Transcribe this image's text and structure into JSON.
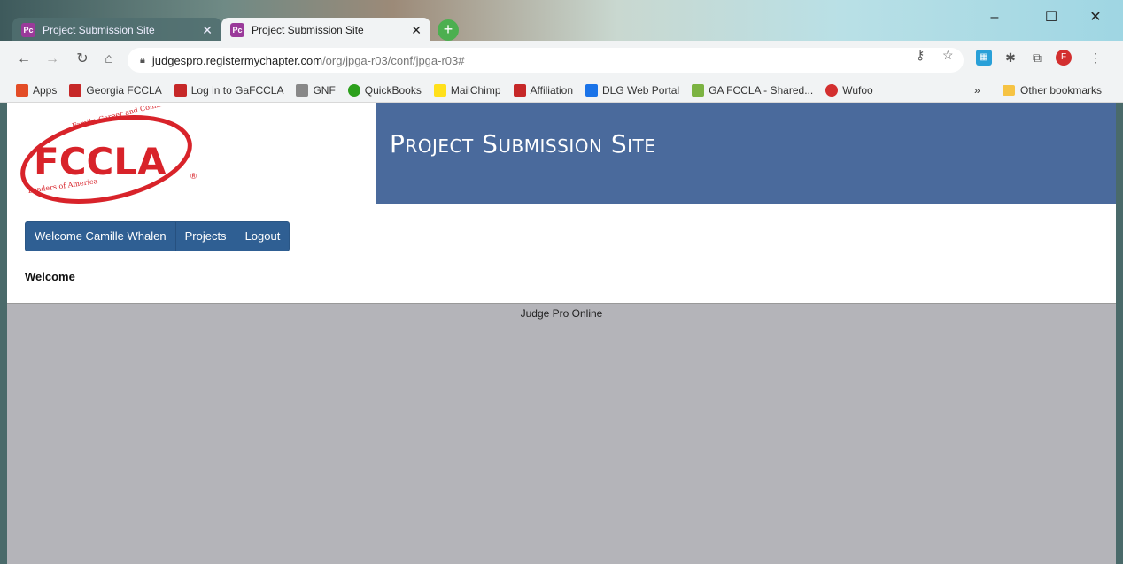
{
  "tabs": [
    {
      "label": "Project Submission Site",
      "favicon": "Pc"
    },
    {
      "label": "Project Submission Site",
      "favicon": "Pc"
    }
  ],
  "address": {
    "host": "judgespro.registermychapter.com",
    "path": "/org/jpga-r03/conf/jpga-r03#"
  },
  "bookmarks": [
    {
      "label": "Apps",
      "color": "#e34c26"
    },
    {
      "label": "Georgia FCCLA",
      "color": "#c62828"
    },
    {
      "label": "Log in to GaFCCLA",
      "color": "#c62828"
    },
    {
      "label": "GNF",
      "color": "#888888"
    },
    {
      "label": "QuickBooks",
      "color": "#2ca01c"
    },
    {
      "label": "MailChimp",
      "color": "#ffe01b"
    },
    {
      "label": "Affiliation",
      "color": "#c62828"
    },
    {
      "label": "DLG Web Portal",
      "color": "#1a73e8"
    },
    {
      "label": "GA FCCLA - Shared...",
      "color": "#7cb342"
    },
    {
      "label": "Wufoo",
      "color": "#d32f2f"
    }
  ],
  "bookmarks_more": "»",
  "other_bookmarks": "Other bookmarks",
  "logo": {
    "main": "FCCLA",
    "arc_top": "Family, Career and Community",
    "arc_bottom": "Leaders of America",
    "reg": "®"
  },
  "banner": {
    "title": "Project Submission Site"
  },
  "nav": {
    "welcome": "Welcome Camille Whalen",
    "projects": "Projects",
    "logout": "Logout"
  },
  "page": {
    "heading": "Welcome",
    "footer": "Judge Pro Online"
  },
  "colors": {
    "banner": "#4a6a9c",
    "nav": "#2f5f93",
    "background": "#b4b4b9"
  }
}
